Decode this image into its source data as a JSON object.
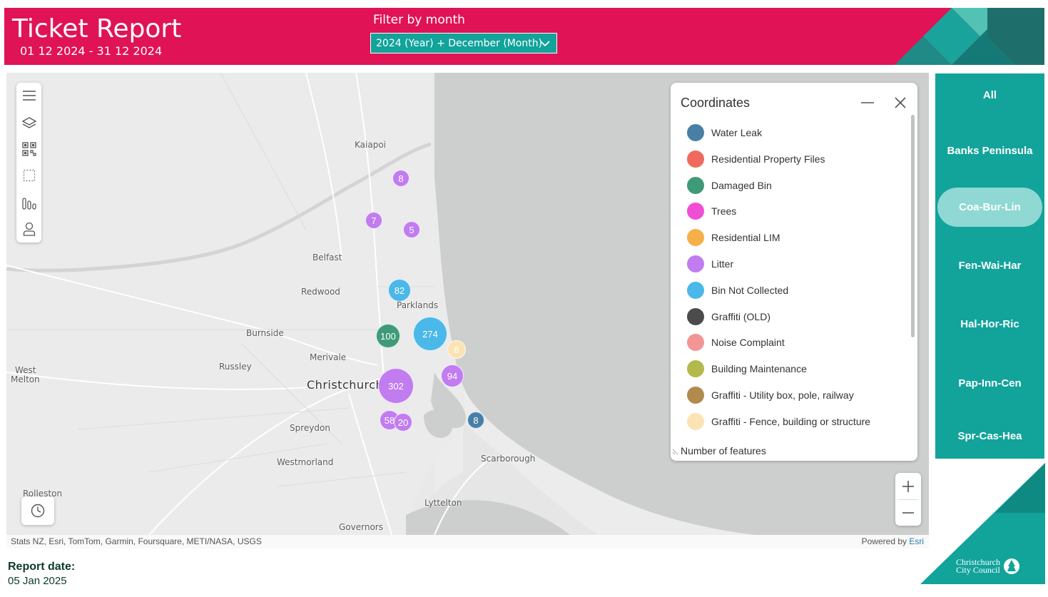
{
  "header": {
    "title": "Ticket Report",
    "date_range": "01 12 2024 - 31 12 2024",
    "filter_label": "Filter by month",
    "filter_value": "2024 (Year) + December (Month)"
  },
  "map": {
    "toolbar": [
      "menu-icon",
      "layers-icon",
      "qr-select-icon",
      "rectangle-select-icon",
      "bar-chart-icon",
      "person-icon"
    ],
    "places": [
      "Kaiapoi",
      "Belfast",
      "Redwood",
      "Parklands",
      "Burnside",
      "Merivale",
      "Russley",
      "West",
      "Melton",
      "Christchurch",
      "Spreydon",
      "Westmorland",
      "Scarborough",
      "Lyttelton",
      "Governors",
      "Rolleston"
    ],
    "clusters": [
      {
        "label": "8",
        "category": "Litter"
      },
      {
        "label": "7",
        "category": "Litter"
      },
      {
        "label": "5",
        "category": "Litter"
      },
      {
        "label": "82",
        "category": "Bin Not Collected"
      },
      {
        "label": "100",
        "category": "Damaged Bin"
      },
      {
        "label": "274",
        "category": "Bin Not Collected"
      },
      {
        "label": "8",
        "category": "Graffiti - Fence, building or structure"
      },
      {
        "label": "94",
        "category": "Litter"
      },
      {
        "label": "302",
        "category": "Litter"
      },
      {
        "label": "58",
        "category": "Litter"
      },
      {
        "label": "20",
        "category": "Litter"
      },
      {
        "label": "8",
        "category": "Water Leak"
      }
    ],
    "attribution": "Stats NZ, Esri, TomTom, Garmin, Foursquare, METI/NASA, USGS",
    "powered_by": "Powered by ",
    "powered_by_link": "Esri"
  },
  "legend": {
    "title": "Coordinates",
    "footer": "Number of features",
    "items": [
      {
        "label": "Water Leak",
        "color": "#4a7fa5"
      },
      {
        "label": "Residential Property Files",
        "color": "#ef6a5d"
      },
      {
        "label": "Damaged Bin",
        "color": "#3f9a78"
      },
      {
        "label": "Trees",
        "color": "#f14ed6"
      },
      {
        "label": "Residential LIM",
        "color": "#f6b04a"
      },
      {
        "label": "Litter",
        "color": "#c17cf0"
      },
      {
        "label": "Bin Not Collected",
        "color": "#4ab8e8"
      },
      {
        "label": "Graffiti (OLD)",
        "color": "#4b4b4b"
      },
      {
        "label": "Noise Complaint",
        "color": "#f49595"
      },
      {
        "label": "Building Maintenance",
        "color": "#b3b94c"
      },
      {
        "label": "Graffiti - Utility box, pole, railway",
        "color": "#b28a4e"
      },
      {
        "label": "Graffiti - Fence, building or structure",
        "color": "#fbe3b4"
      }
    ]
  },
  "nav": {
    "items": [
      {
        "label": "All",
        "active": false
      },
      {
        "label": "Banks Peninsula",
        "active": false
      },
      {
        "label": "Coa-Bur-Lin",
        "active": true
      },
      {
        "label": "Fen-Wai-Har",
        "active": false
      },
      {
        "label": "Hal-Hor-Ric",
        "active": false
      },
      {
        "label": "Pap-Inn-Cen",
        "active": false
      },
      {
        "label": "Spr-Cas-Hea",
        "active": false
      }
    ]
  },
  "logo": {
    "line1": "Christchurch",
    "line2": "City Council"
  },
  "report": {
    "label": "Report date:",
    "date": "05 Jan 2025"
  },
  "colors": {
    "header": "#e01356",
    "teal": "#12a39b",
    "teal_active": "#8fd8d3"
  }
}
